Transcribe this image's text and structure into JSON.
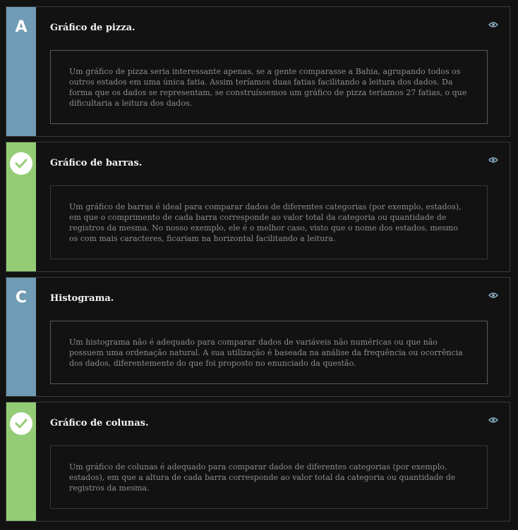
{
  "options": [
    {
      "marker": "A",
      "marker_type": "letter",
      "marker_color": "#6f9bb4",
      "title": "Gráfico de pizza.",
      "description": "Um gráfico de pizza seria interessante apenas, se a gente comparasse a Bahia, agrupando todos os outros estados em uma única fatia. Assim teríamos duas fatias facilitando a leitura dos dados. Da forma que os dados se representam, se construíssemos um gráfico de pizza teríamos 27 fatias, o que dificultaria a leitura dos dados.",
      "icon": "eye-icon"
    },
    {
      "marker": "",
      "marker_type": "check",
      "marker_color": "#94cc76",
      "title": "Gráfico de barras.",
      "description": "Um gráfico de barras é ideal para comparar dados de diferentes categorias (por exemplo, estados), em que o comprimento de cada barra corresponde ao valor total da categoria ou quantidade de registros da mesma. No nosso exemplo, ele é o melhor caso, visto que o nome dos estados, mesmo os com mais caracteres, ficariam na horizontal facilitando a leitura.",
      "icon": "eye-icon"
    },
    {
      "marker": "C",
      "marker_type": "letter",
      "marker_color": "#6f9bb4",
      "title": "Histograma.",
      "description": "Um histograma não é adequado para comparar dados de variáveis não numéricas ou que não possuem uma ordenação natural. A sua utilização é baseada na análise da frequência ou ocorrência dos dados, diferentemente do que foi proposto no enunciado da questão.",
      "icon": "eye-icon"
    },
    {
      "marker": "",
      "marker_type": "check",
      "marker_color": "#94cc76",
      "title": "Gráfico de colunas.",
      "description": "Um gráfico de colunas é adequado para comparar dados de diferentes categorias (por exemplo, estados), em que a altura de cada barra corresponde ao valor total da categoria ou quantidade de registros da mesma.",
      "icon": "eye-icon"
    }
  ]
}
